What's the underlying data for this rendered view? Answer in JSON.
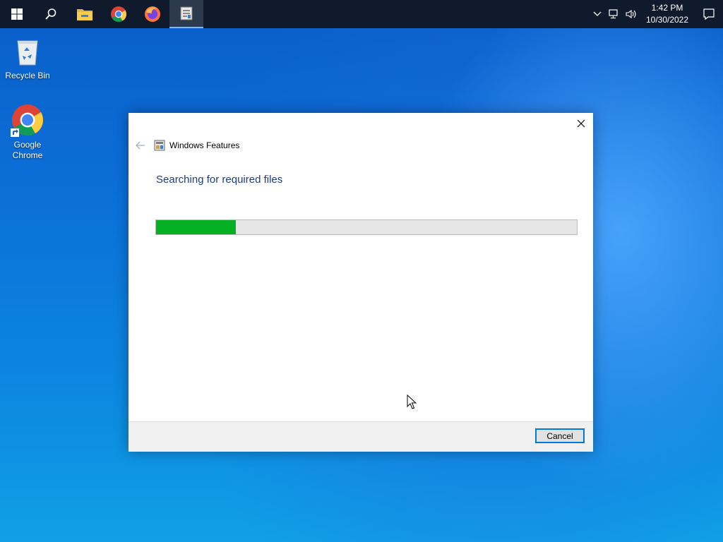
{
  "taskbar": {
    "apps": [
      {
        "name": "start-icon"
      },
      {
        "name": "search-icon"
      },
      {
        "name": "file-explorer-icon"
      },
      {
        "name": "chrome-icon"
      },
      {
        "name": "firefox-icon"
      },
      {
        "name": "windows-features-icon",
        "active": true
      }
    ],
    "clock": {
      "time": "1:42 PM",
      "date": "10/30/2022"
    }
  },
  "desktop": {
    "icons": [
      {
        "label": "Recycle Bin",
        "icon": "recycle-bin-icon"
      },
      {
        "label": "Google Chrome",
        "icon": "chrome-icon"
      }
    ]
  },
  "dialog": {
    "title": "Windows Features",
    "heading": "Searching for required files",
    "progress": 0.19,
    "cancel_label": "Cancel"
  },
  "colors": {
    "progress_fill": "#06b025",
    "heading_text": "#1e3e7a",
    "accent": "#0078d7",
    "taskbar": "#0f1b2d"
  }
}
